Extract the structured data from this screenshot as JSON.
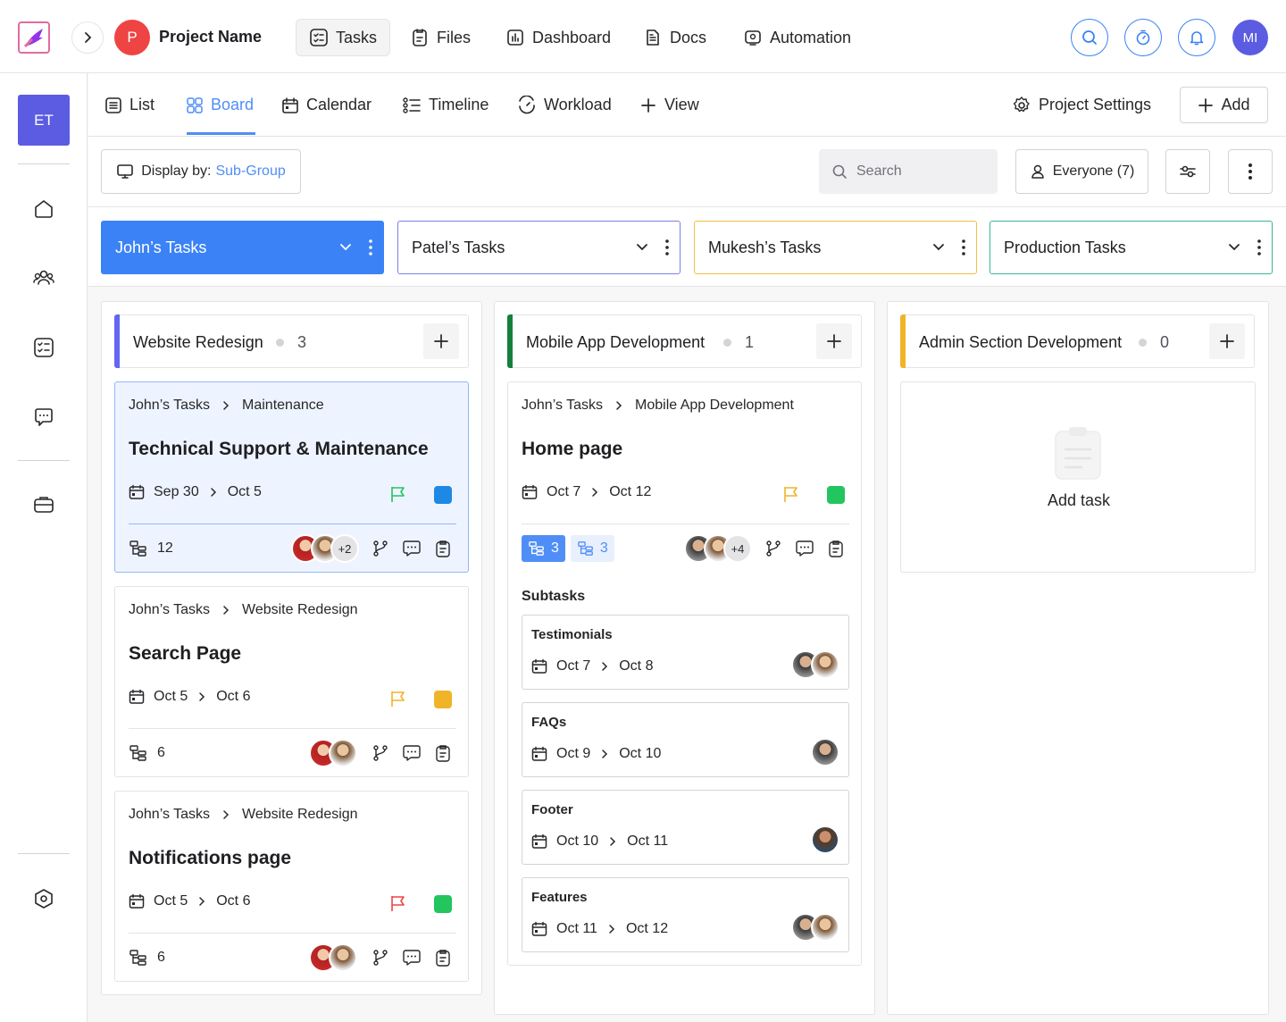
{
  "header": {
    "project_initial": "P",
    "project_name": "Project Name",
    "nav": [
      {
        "label": "Tasks",
        "icon": "tasks-icon"
      },
      {
        "label": "Files",
        "icon": "file-icon"
      },
      {
        "label": "Dashboard",
        "icon": "dashboard-icon"
      },
      {
        "label": "Docs",
        "icon": "docs-icon"
      },
      {
        "label": "Automation",
        "icon": "automation-icon"
      }
    ],
    "user_initials": "MI"
  },
  "sidebar": {
    "workspace_initials": "ET",
    "items": [
      "home-icon",
      "team-icon",
      "tasks-icon",
      "chat-icon",
      "briefcase-icon",
      "settings-icon"
    ]
  },
  "views": {
    "tabs": [
      {
        "label": "List",
        "icon": "list-icon"
      },
      {
        "label": "Board",
        "icon": "board-icon"
      },
      {
        "label": "Calendar",
        "icon": "calendar-icon"
      },
      {
        "label": "Timeline",
        "icon": "timeline-icon"
      },
      {
        "label": "Workload",
        "icon": "workload-icon"
      },
      {
        "label": "View",
        "icon": "plus-icon"
      }
    ],
    "active_tab": "Board",
    "project_settings": "Project Settings",
    "add": "Add"
  },
  "filters": {
    "display_by_label": "Display by:",
    "display_by_value": "Sub-Group",
    "search_placeholder": "Search",
    "everyone": "Everyone (7)"
  },
  "groups": [
    "John’s Tasks",
    "Patel’s Tasks",
    "Mukesh’s Tasks",
    "Production Tasks"
  ],
  "group_colors": [
    "#3b82f6",
    "#7c7fe6",
    "#f0c040",
    "#3bb59a"
  ],
  "columns": [
    {
      "title": "Website Redesign",
      "count": "3",
      "color": "#6366f1",
      "cards": [
        {
          "crumb_parent": "John’s Tasks",
          "crumb_child": "Maintenance",
          "title": "Technical Support & Maintenance",
          "start": "Sep 30",
          "end": "Oct 5",
          "flag_color": "#22c55e",
          "status_color": "#1e88e5",
          "subtasks": "12",
          "extra_assignees": "+2"
        },
        {
          "crumb_parent": "John’s Tasks",
          "crumb_child": "Website Redesign",
          "title": "Search Page",
          "start": "Oct 5",
          "end": "Oct 6",
          "flag_color": "#f0b429",
          "status_color": "#f0b429",
          "subtasks": "6"
        },
        {
          "crumb_parent": "John’s Tasks",
          "crumb_child": "Website Redesign",
          "title": "Notifications page",
          "start": "Oct 5",
          "end": "Oct 6",
          "flag_color": "#ef4444",
          "status_color": "#22c55e",
          "subtasks": "6"
        }
      ]
    },
    {
      "title": "Mobile App Development",
      "count": "1",
      "color": "#15803d",
      "cards": [
        {
          "crumb_parent": "John’s Tasks",
          "crumb_child": "Mobile App Development",
          "title": "Home page",
          "start": "Oct 7",
          "end": "Oct 12",
          "flag_color": "#f0b429",
          "status_color": "#22c55e",
          "chip_a": "3",
          "chip_b": "3",
          "extra_assignees": "+4",
          "subtasks_label": "Subtasks",
          "subtask_list": [
            {
              "title": "Testimonials",
              "start": "Oct 7",
              "end": "Oct 8"
            },
            {
              "title": "FAQs",
              "start": "Oct 9",
              "end": "Oct 10"
            },
            {
              "title": "Footer",
              "start": "Oct 10",
              "end": "Oct 11"
            },
            {
              "title": "Features",
              "start": "Oct 11",
              "end": "Oct 12"
            }
          ]
        }
      ]
    },
    {
      "title": "Admin Section Development",
      "count": "0",
      "color": "#f0b429",
      "empty_label": "Add task"
    }
  ]
}
